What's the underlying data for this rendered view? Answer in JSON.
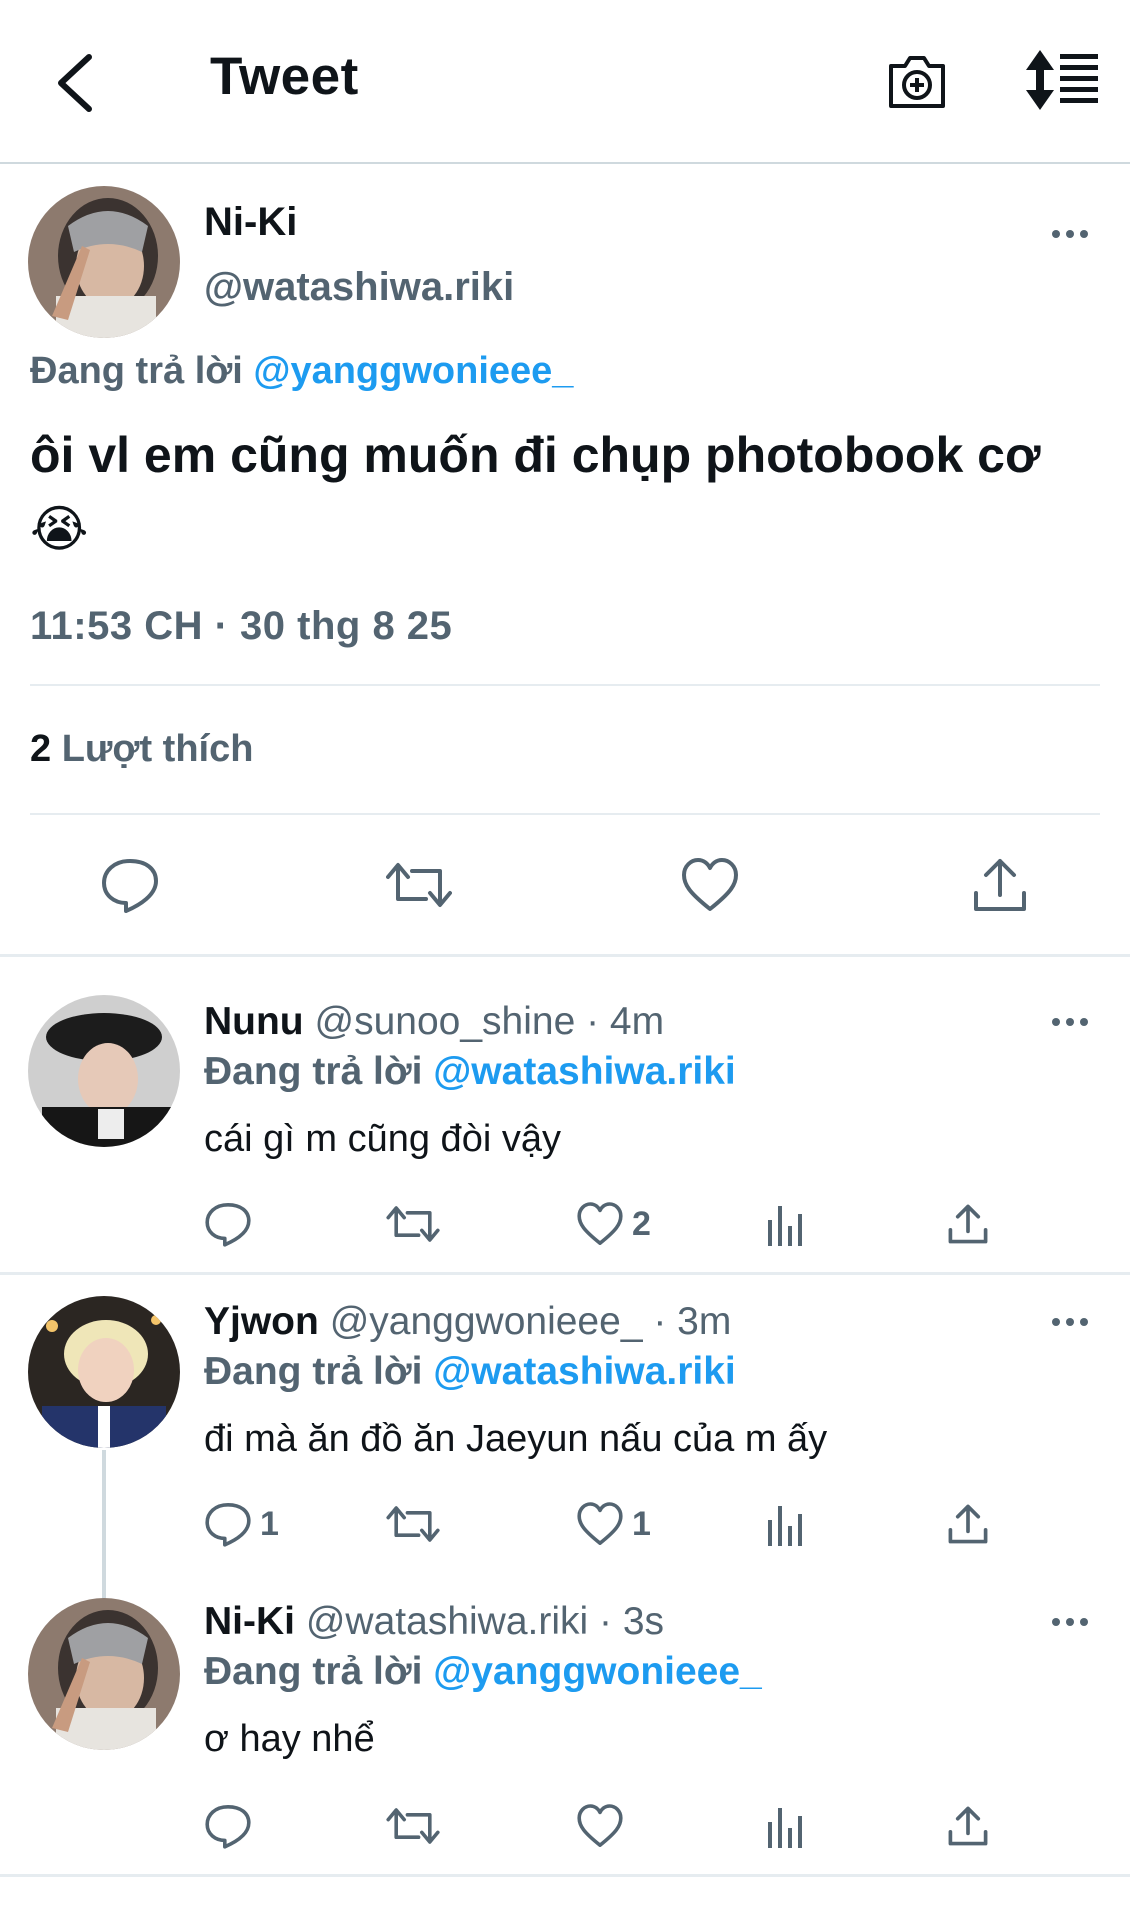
{
  "header": {
    "title": "Tweet"
  },
  "main_tweet": {
    "name": "Ni-Ki",
    "handle": "@watashiwa.riki",
    "replying_label": "Đang trả lời",
    "replying_to": "@yanggwonieee_",
    "text": "ôi vl em cũng muốn đi chụp photobook cơ 😭",
    "timestamp": "11:53 CH · 30 thg 8 25",
    "likes_count": "2",
    "likes_label": "Lượt thích"
  },
  "replies": [
    {
      "name": "Nunu",
      "handle": "@sunoo_shine",
      "time": "· 4m",
      "replying_label": "Đang trả lời",
      "replying_to": "@watashiwa.riki",
      "text": "cái gì m cũng đòi vậy",
      "reply_count": "",
      "like_count": "2"
    },
    {
      "name": "Yjwon",
      "handle": "@yanggwonieee_",
      "time": "· 3m",
      "replying_label": "Đang trả lời",
      "replying_to": "@watashiwa.riki",
      "text": "đi mà ăn đồ ăn Jaeyun nấu của m ấy",
      "reply_count": "1",
      "like_count": "1"
    },
    {
      "name": "Ni-Ki",
      "handle": "@watashiwa.riki",
      "time": "· 3s",
      "replying_label": "Đang trả lời",
      "replying_to": "@yanggwonieee_",
      "text": "ơ hay nhể",
      "reply_count": "",
      "like_count": ""
    }
  ],
  "colors": {
    "accent": "#1d9bf0",
    "secondary_text": "#536471",
    "primary_text": "#0f1419",
    "divider": "#e6ecf0"
  },
  "icons": [
    "back-arrow-icon",
    "camera-add-icon",
    "sort-icon",
    "more-icon",
    "reply-icon",
    "retweet-icon",
    "like-icon",
    "share-icon",
    "analytics-icon"
  ]
}
